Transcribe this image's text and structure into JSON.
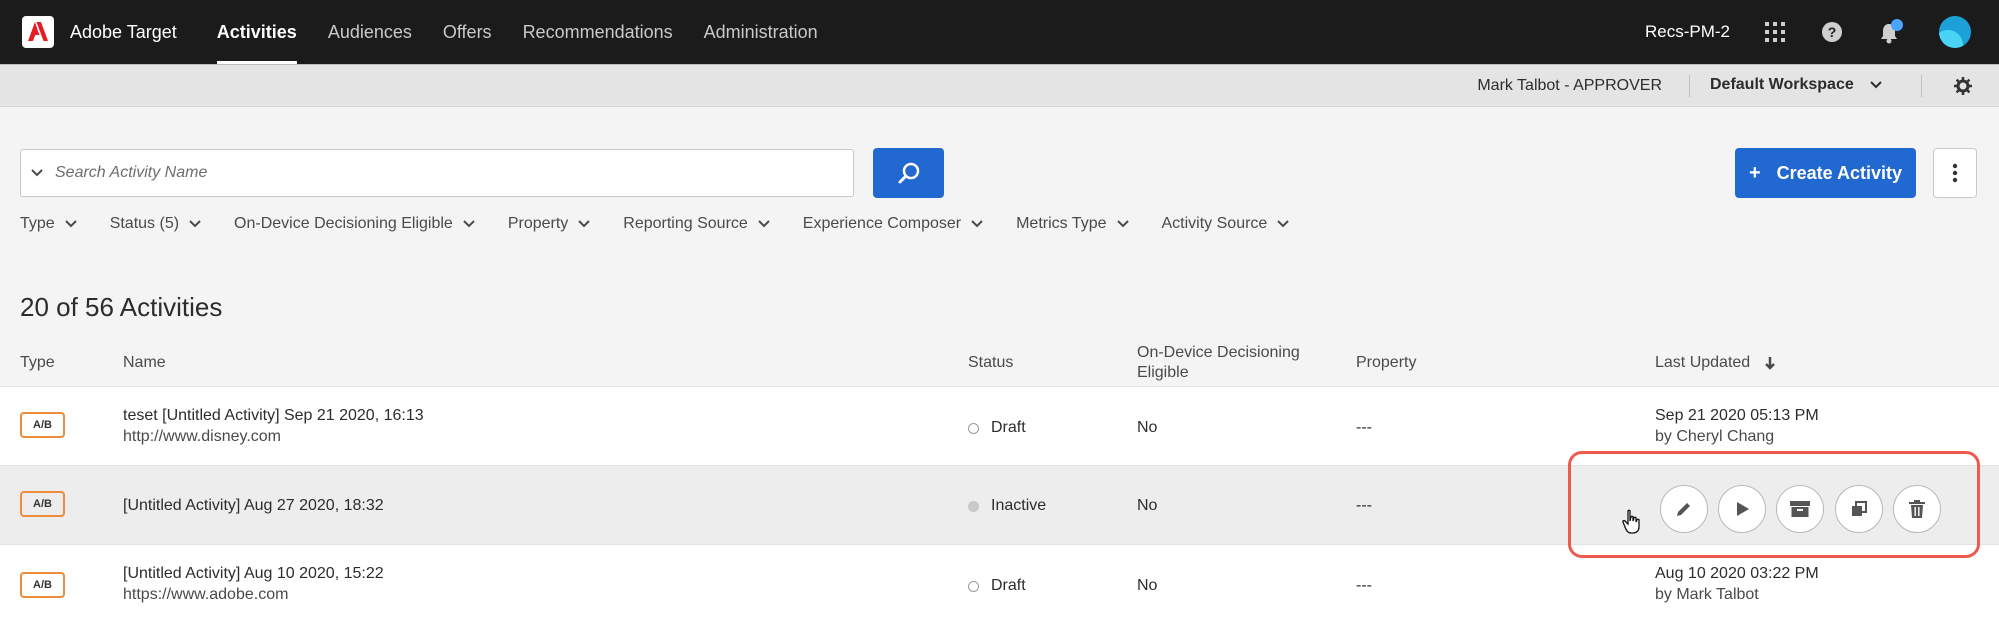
{
  "app": {
    "name": "Adobe Target"
  },
  "nav": {
    "items": [
      {
        "label": "Activities",
        "active": true
      },
      {
        "label": "Audiences",
        "active": false
      },
      {
        "label": "Offers",
        "active": false
      },
      {
        "label": "Recommendations",
        "active": false
      },
      {
        "label": "Administration",
        "active": false
      }
    ],
    "org": "Recs-PM-2",
    "icons": [
      "apps-grid-icon",
      "help-icon",
      "notifications-icon",
      "avatar"
    ],
    "notification_dot_color": "#4aa3ff"
  },
  "subbar": {
    "user_role": "Mark Talbot - APPROVER",
    "workspace": "Default Workspace"
  },
  "search": {
    "placeholder": "Search Activity Name"
  },
  "toolbar": {
    "create_label": "Create Activity",
    "create_plus": "+"
  },
  "filters": [
    "Type",
    "Status (5)",
    "On-Device Decisioning Eligible",
    "Property",
    "Reporting Source",
    "Experience Composer",
    "Metrics Type",
    "Activity Source"
  ],
  "count_label": "20 of 56 Activities",
  "table": {
    "headers": {
      "type": "Type",
      "name": "Name",
      "status": "Status",
      "odd_line1": "On-Device Decisioning",
      "odd_line2": "Eligible",
      "property": "Property",
      "last_updated": "Last Updated"
    },
    "rows": [
      {
        "type": "A/B",
        "name": "teset [Untitled Activity] Sep 21 2020, 16:13",
        "url": "http://www.disney.com",
        "status": "Draft",
        "odd": "No",
        "property": "---",
        "updated": "Sep 21 2020 05:13 PM",
        "updated_by": "by Cheryl Chang"
      },
      {
        "type": "A/B",
        "name": "[Untitled Activity] Aug 27 2020, 18:32",
        "url": "",
        "status": "Inactive",
        "odd": "No",
        "property": "---",
        "updated": "",
        "updated_by": ""
      },
      {
        "type": "A/B",
        "name": "[Untitled Activity] Aug 10 2020, 15:22",
        "url": "https://www.adobe.com",
        "status": "Draft",
        "odd": "No",
        "property": "---",
        "updated": "Aug 10 2020 03:22 PM",
        "updated_by": "by Mark Talbot"
      }
    ]
  },
  "row_actions": [
    "edit-icon",
    "play-icon",
    "archive-icon",
    "copy-icon",
    "delete-icon"
  ],
  "colors": {
    "accent": "#2168d0",
    "highlight": "#ee5a4d",
    "type_badge": "#ef8c3a",
    "topbar": "#1b1b1b"
  }
}
